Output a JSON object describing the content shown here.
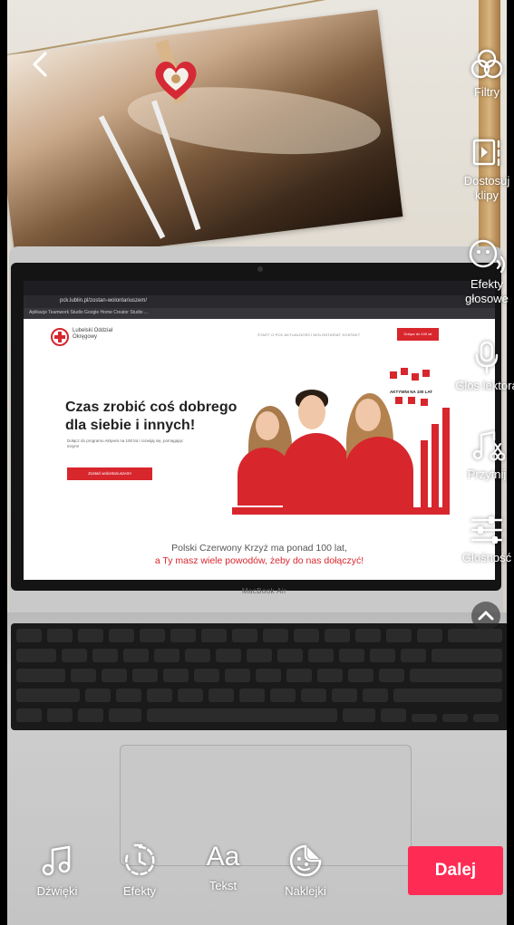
{
  "nav": {
    "back_icon": "chevron-left-icon"
  },
  "side_tools": [
    {
      "label": "Filtry",
      "icon": "filters-icon"
    },
    {
      "label": "Dostosuj klipy",
      "icon": "adjust-clips-icon"
    },
    {
      "label": "Efekty głosowe",
      "icon": "voice-effects-icon"
    },
    {
      "label": "Głos lektora",
      "icon": "microphone-icon"
    },
    {
      "label": "Przytnij",
      "icon": "trim-music-icon"
    },
    {
      "label": "Głośność",
      "icon": "volume-sliders-icon"
    }
  ],
  "bottom_tools": [
    {
      "label": "Dźwięki",
      "icon": "music-note-icon"
    },
    {
      "label": "Efekty",
      "icon": "effects-timer-icon"
    },
    {
      "label": "Tekst",
      "icon": "text-aa-icon",
      "glyph": "Aa"
    },
    {
      "label": "Naklejki",
      "icon": "sticker-icon"
    }
  ],
  "next_button": {
    "label": "Dalej",
    "color": "#fe2c55"
  },
  "video": {
    "browser_address": "pck.lublin.pl/zostan-wolontariuszem/",
    "bookmarks": "Aplikacje  Teamwork  Studio  Google  Home  Creator Studio  ...",
    "site_logo_text": "Lubelski Oddział Okręgowy",
    "site_nav": "START   O PCK   AKTUALNOŚCI   WOLONTARIAT   KONTAKT",
    "site_nav_button": "Dołącz do 100 lat",
    "hero_title": "Czas zrobić coś dobrego dla siebie i innych!",
    "hero_subtitle": "Dołącz do programu Aktywni na 100 lat i rozwijaj się, pomagając innym!",
    "hero_button": "Zostań wolontariuszem!",
    "badge": "AKTYWNI NA 100 LAT",
    "footer_line1": "Polski Czerwony Krzyż ma ponad 100 lat,",
    "footer_line2": "a Ty masz wiele powodów, żeby do nas dołączyć!",
    "laptop_brand": "MacBook Air",
    "accent_color": "#d8262d"
  }
}
